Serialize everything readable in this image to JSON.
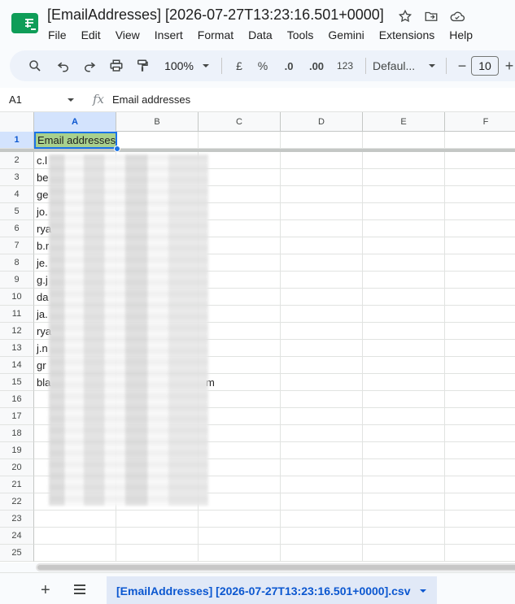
{
  "window": {
    "title": "[EmailAddresses] [2026-07-27T13:23:16.501+0000]"
  },
  "menu": [
    "File",
    "Edit",
    "View",
    "Insert",
    "Format",
    "Data",
    "Tools",
    "Gemini",
    "Extensions",
    "Help"
  ],
  "toolbar": {
    "zoom": "100%",
    "currency": "£",
    "percent": "%",
    "decrease_decimal": ".0",
    "increase_decimal": ".00",
    "number_format": "123",
    "font": "Defaul...",
    "font_size": "10",
    "minus": "−",
    "plus": "+"
  },
  "formula_bar": {
    "cell_ref": "A1",
    "fx": "fx",
    "content": "Email addresses"
  },
  "grid": {
    "columns": [
      "A",
      "B",
      "C",
      "D",
      "E",
      "F"
    ],
    "rows": [
      "1",
      "2",
      "3",
      "4",
      "5",
      "6",
      "7",
      "8",
      "9",
      "10",
      "11",
      "12",
      "13",
      "14",
      "15",
      "16",
      "17",
      "18",
      "19",
      "20",
      "21",
      "22",
      "23",
      "24",
      "25"
    ],
    "header_cell": "Email addresses",
    "data_cells": [
      "c.l",
      "be",
      "ge",
      "jo.",
      "rya",
      "b.r",
      "je.",
      "g.j",
      "da",
      "ja.",
      "rya",
      "j.n",
      "gr",
      "bla",
      "m"
    ]
  },
  "bottom": {
    "add": "+",
    "sheet_tab": "[EmailAddresses] [2026-07-27T13:23:16.501+0000].csv"
  },
  "colors": {
    "accent": "#0b57d0",
    "header_fill": "#a8d08d",
    "selection": "#1a73e8"
  }
}
